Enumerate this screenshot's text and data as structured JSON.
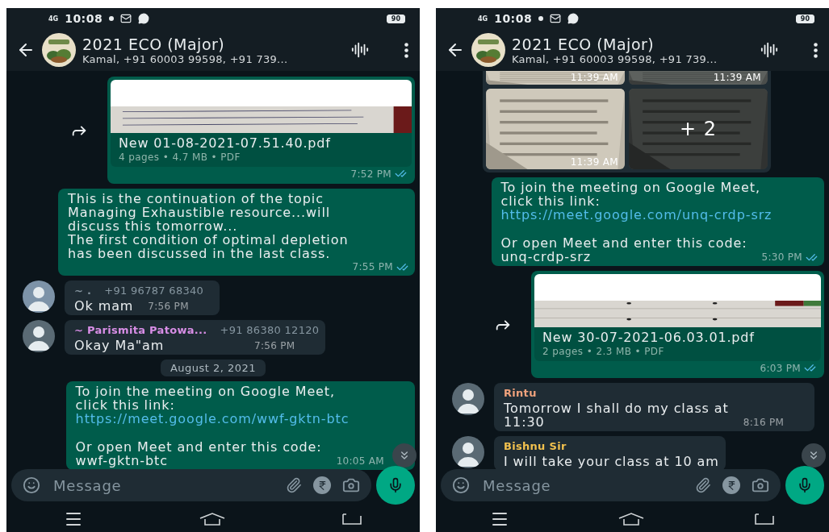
{
  "phones": [
    {
      "status_bar": {
        "network": "4G",
        "time": "10:08",
        "battery": "90"
      },
      "header": {
        "title": "2021 ECO (Major)",
        "subtitle": "Kamal, +91 60003 99598, +91 739..."
      },
      "messages": [
        {
          "kind": "document",
          "outgoing": true,
          "file_name": "New 01-08-2021-07.51.40.pdf",
          "meta": "4 pages • 4.7 MB • PDF",
          "time": "7:52 PM",
          "read": true
        },
        {
          "kind": "text",
          "outgoing": true,
          "body": [
            {
              "kind": "plain",
              "text": "This is the continuation of the topic\nManaging Exhaustible resource...will\ndiscuss this tomorrow...\nThe first condition of optimal depletion\nhas been discussed in the last class."
            }
          ],
          "time": "7:55 PM",
          "read": true
        },
        {
          "kind": "text",
          "outgoing": false,
          "sender": "~ .",
          "color": "#8696a0",
          "phone": "+91 96787 68340",
          "body": [
            {
              "kind": "plain",
              "text": "Ok mam"
            }
          ],
          "time": "7:56 PM"
        },
        {
          "kind": "text",
          "outgoing": false,
          "sender": "~ Parismita Patowa...",
          "color": "#d88ee6",
          "phone": "+91 86380 12120",
          "body": [
            {
              "kind": "plain",
              "text": "Okay Ma\"am"
            }
          ],
          "time": "7:56 PM"
        },
        {
          "kind": "date",
          "label": "August 2, 2021"
        },
        {
          "kind": "text",
          "outgoing": true,
          "body": [
            {
              "kind": "plain",
              "text": "To join the meeting on Google Meet,\nclick this link:"
            },
            {
              "kind": "link",
              "text": "https://meet.google.com/wwf-gktn-btc"
            },
            {
              "kind": "plain",
              "text": "Or open Meet and enter this code:\nwwf-gktn-btc"
            }
          ],
          "time": "10:05 AM"
        }
      ],
      "composer": {
        "placeholder": "Message"
      }
    },
    {
      "status_bar": {
        "network": "4G",
        "time": "10:08",
        "battery": "90"
      },
      "header": {
        "title": "2021 ECO (Major)",
        "subtitle": "Kamal, +91 60003 99598, +91 739..."
      },
      "messages": [
        {
          "kind": "media_grid",
          "outgoing": false,
          "tiles": [
            {
              "kind": "picture",
              "time": "11:39 AM"
            },
            {
              "kind": "picture",
              "time": "11:39 AM"
            },
            {
              "kind": "picture",
              "time": "11:39 AM"
            },
            {
              "kind": "picture",
              "more": "+ 2"
            }
          ]
        },
        {
          "kind": "text",
          "outgoing": true,
          "body": [
            {
              "kind": "plain",
              "text": "To join the meeting on Google Meet,\nclick this link:"
            },
            {
              "kind": "link",
              "text": "https://meet.google.com/unq-crdp-srz"
            },
            {
              "kind": "plain",
              "text": "Or open Meet and enter this code:\nunq-crdp-srz"
            }
          ],
          "time": "5:30 PM",
          "read": true
        },
        {
          "kind": "document",
          "outgoing": true,
          "file_name": "New 30-07-2021-06.03.01.pdf",
          "meta": "2 pages • 2.3 MB • PDF",
          "time": "6:03 PM",
          "read": true
        },
        {
          "kind": "text",
          "outgoing": false,
          "sender": "Rintu",
          "color": "#f0a27c",
          "body": [
            {
              "kind": "plain",
              "text": "Tomorrow I shall do my class at\n11:30"
            }
          ],
          "time": "8:16 PM"
        },
        {
          "kind": "text",
          "outgoing": false,
          "sender": "Bishnu Sir",
          "color": "#f2c14e",
          "body": [
            {
              "kind": "plain",
              "text": "I will take your class at 10 am"
            }
          ]
        }
      ],
      "composer": {
        "placeholder": "Message"
      }
    }
  ]
}
